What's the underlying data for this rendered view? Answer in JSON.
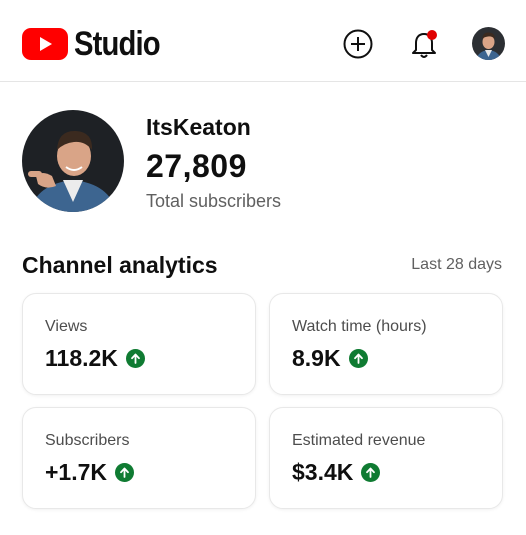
{
  "header": {
    "app_name": "Studio",
    "icons": {
      "logo": "youtube-play-icon",
      "create": "plus-circle-icon",
      "notifications": "bell-icon",
      "account": "avatar"
    },
    "notification_dot": true
  },
  "channel": {
    "name": "ItsKeaton",
    "subscriber_count": "27,809",
    "subscriber_label": "Total subscribers"
  },
  "analytics": {
    "title": "Channel analytics",
    "period": "Last 28 days",
    "metrics": [
      {
        "label": "Views",
        "value": "118.2K",
        "trend": "up"
      },
      {
        "label": "Watch time (hours)",
        "value": "8.9K",
        "trend": "up"
      },
      {
        "label": "Subscribers",
        "value": "+1.7K",
        "trend": "up"
      },
      {
        "label": "Estimated revenue",
        "value": "$3.4K",
        "trend": "up"
      }
    ]
  },
  "colors": {
    "brand_red": "#ff0000",
    "trend_up": "#0f7b32",
    "notification_dot": "#e00000"
  }
}
